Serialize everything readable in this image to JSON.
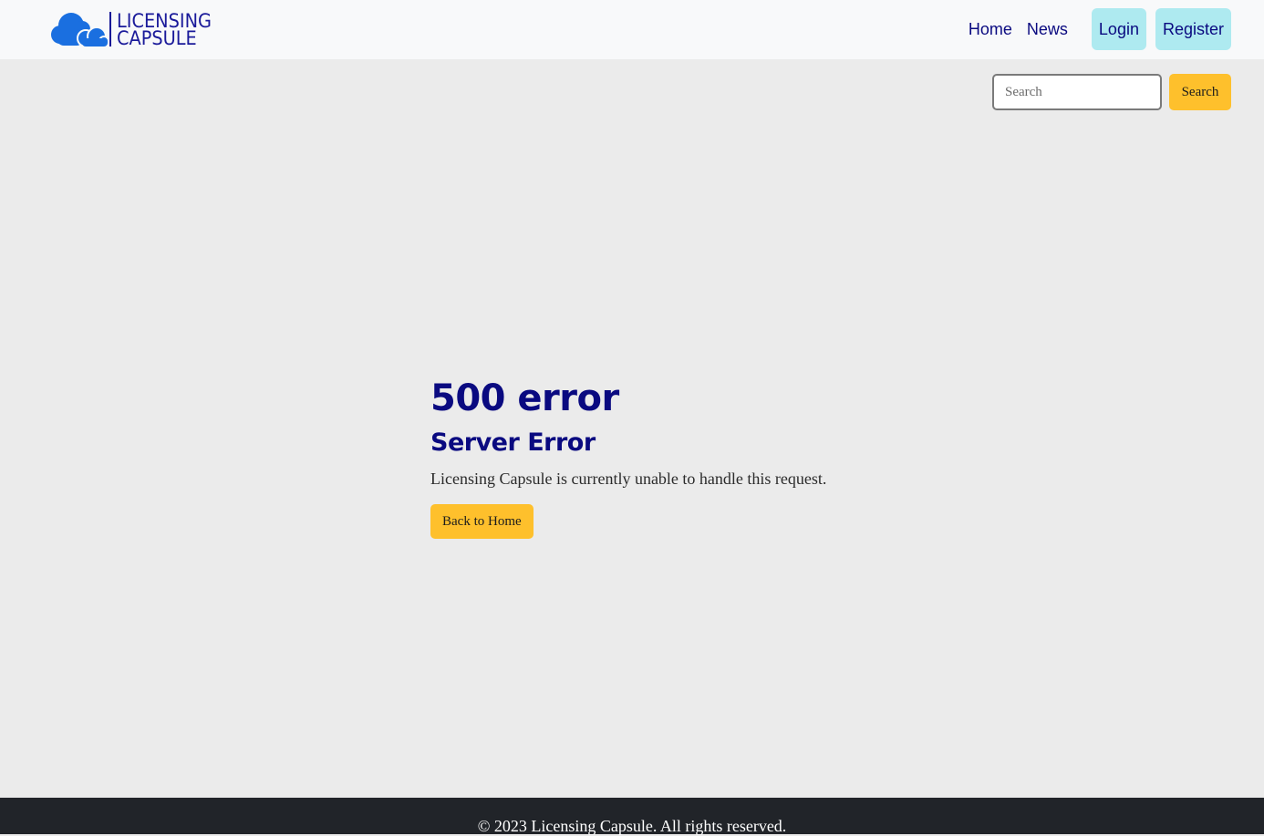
{
  "brand": {
    "logo_line1": "LICENSING",
    "logo_line2": "CAPSULE",
    "logo_icon": "cloud-icon",
    "accent_color": "#1a6fe0",
    "text_color": "#0a0a80"
  },
  "nav": {
    "home": "Home",
    "news": "News",
    "login": "Login",
    "register": "Register",
    "button_color": "#aeeaf0"
  },
  "search": {
    "placeholder": "Search",
    "button_label": "Search",
    "button_color": "#fec02c"
  },
  "error": {
    "code": "500 error",
    "title": "Server Error",
    "message": "Licensing Capsule is currently unable to handle this request.",
    "back_button": "Back to Home"
  },
  "footer": {
    "text": "© 2023 Licensing Capsule. All rights reserved.",
    "background": "#212429"
  }
}
